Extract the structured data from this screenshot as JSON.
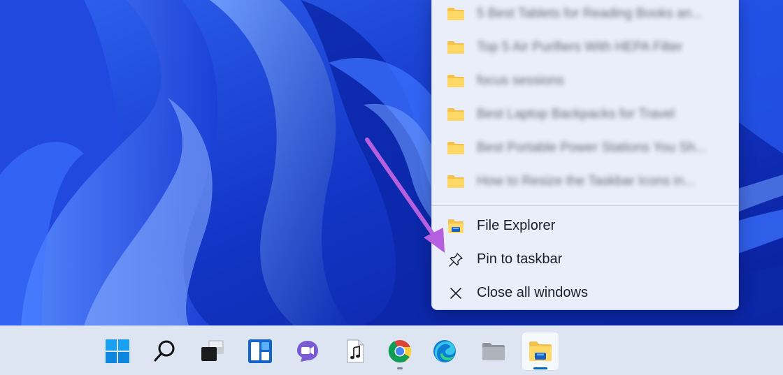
{
  "desktop": {
    "wallpaper": "windows-11-bloom-wallpaper"
  },
  "jump_list": {
    "recent_items": [
      {
        "label": "5 Best Tablets for Reading Books an...",
        "icon": "folder-icon"
      },
      {
        "label": "Top 5 Air Purifiers With HEPA Filter",
        "icon": "folder-icon"
      },
      {
        "label": "focus sessions",
        "icon": "folder-icon"
      },
      {
        "label": "Best Laptop Backpacks for Travel",
        "icon": "folder-icon"
      },
      {
        "label": "Best Portable Power Stations You Sh...",
        "icon": "folder-icon"
      },
      {
        "label": "How to Resize the Taskbar Icons in...",
        "icon": "folder-icon"
      }
    ],
    "actions": [
      {
        "label": "File Explorer",
        "icon": "file-explorer-icon"
      },
      {
        "label": "Pin to taskbar",
        "icon": "pin-icon"
      },
      {
        "label": "Close all windows",
        "icon": "close-icon"
      }
    ]
  },
  "taskbar": {
    "buttons": [
      {
        "name": "start",
        "icon": "windows-logo-icon"
      },
      {
        "name": "search",
        "icon": "search-icon"
      },
      {
        "name": "task-view",
        "icon": "task-view-icon"
      },
      {
        "name": "widgets",
        "icon": "widgets-icon"
      },
      {
        "name": "chat",
        "icon": "teams-chat-icon"
      },
      {
        "name": "music-file",
        "icon": "music-file-icon"
      },
      {
        "name": "chrome",
        "icon": "chrome-icon",
        "running": true
      },
      {
        "name": "edge",
        "icon": "edge-icon"
      },
      {
        "name": "folder",
        "icon": "folder-icon"
      },
      {
        "name": "file-explorer",
        "icon": "file-explorer-icon",
        "active": true
      }
    ]
  },
  "colors": {
    "wallpaper_blue": "#1a3fd0",
    "menu_bg": "#e9eefa",
    "taskbar_bg": "#dde5f3",
    "accent": "#0067c0",
    "annotation_arrow": "#b660e0"
  }
}
